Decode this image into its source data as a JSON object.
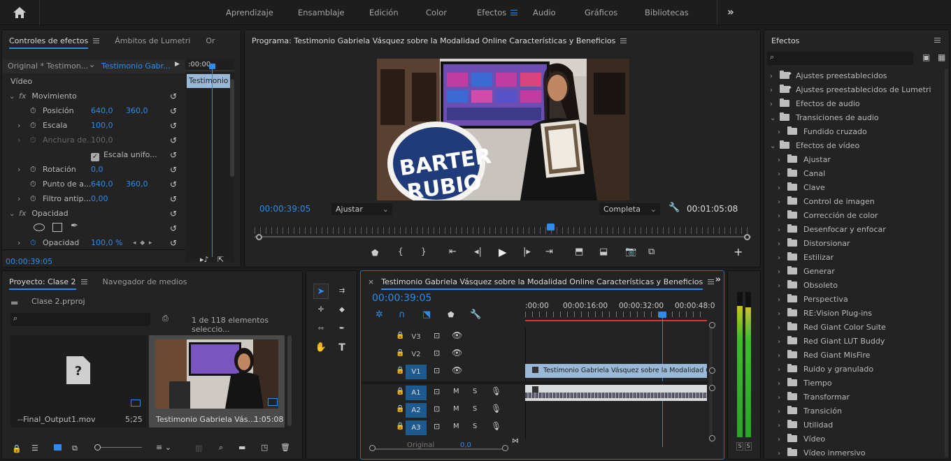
{
  "workspaces": {
    "items": [
      "Aprendizaje",
      "Ensamblaje",
      "Edición",
      "Color",
      "Efectos",
      "Audio",
      "Gráficos",
      "Bibliotecas"
    ],
    "active": "Efectos"
  },
  "effect_controls": {
    "tabs": [
      "Controles de efectos",
      "Ámbitos de Lumetri",
      "Or"
    ],
    "source_master": "Original * Testimon...",
    "source_clip": "Testimonio Gabr...",
    "clip_label": "Testimonio",
    "ruler_time": ":00:00",
    "section": "Vídeo",
    "motion": {
      "label": "Movimiento",
      "position_label": "Posición",
      "position_x": "640,0",
      "position_y": "360,0",
      "scale_label": "Escala",
      "scale": "100,0",
      "width_label": "Anchura de...",
      "width": "100,0",
      "uniform_label": "Escala unifo...",
      "rotation_label": "Rotación",
      "rotation": "0,0",
      "anchor_label": "Punto de a...",
      "anchor_x": "640,0",
      "anchor_y": "360,0",
      "flicker_label": "Filtro antip...",
      "flicker": "0,00"
    },
    "opacity": {
      "label": "Opacidad",
      "value_label": "Opacidad",
      "value": "100,0 %"
    },
    "timecode": "00:00:39:05"
  },
  "program": {
    "title": "Programa: Testimonio Gabriela Vásquez sobre la Modalidad Online Características y Beneficios",
    "timecode": "00:00:39:05",
    "fit": "Ajustar",
    "quality": "Completa",
    "duration": "00:01:05:08",
    "banner_line1": "BARTER",
    "banner_line2": "RUBIO"
  },
  "project": {
    "tabs": [
      "Proyecto: Clase 2",
      "Navegador de medios"
    ],
    "file": "Clase 2.prproj",
    "count": "1 de 118 elementos seleccio...",
    "items": [
      {
        "name": "--Final_Output1.mov",
        "duration": "5;25"
      },
      {
        "name": "Testimonio Gabriela Vás...",
        "duration": "1:05:08"
      }
    ]
  },
  "timeline": {
    "title": "Testimonio Gabriela Vásquez sobre la Modalidad Online Características y Beneficios",
    "timecode": "00:00:39:05",
    "ruler": [
      ":00:00",
      "00:00:16:00",
      "00:00:32:00",
      "00:00:48:0"
    ],
    "tracks": [
      "V3",
      "V2",
      "V1",
      "A1",
      "A2",
      "A3"
    ],
    "clip_name": "Testimonio Gabriela Vásquez sobre la Modalidad Online C",
    "master_label": "Original",
    "master_value": "0,0",
    "mute": "M",
    "solo": "S"
  },
  "effects": {
    "title": "Efectos",
    "items": [
      {
        "label": "Ajustes preestablecidos",
        "level": 0,
        "star": true,
        "open": false
      },
      {
        "label": "Ajustes preestablecidos de Lumetri",
        "level": 0,
        "star": true,
        "open": false
      },
      {
        "label": "Efectos de audio",
        "level": 0,
        "open": false
      },
      {
        "label": "Transiciones de audio",
        "level": 0,
        "open": true
      },
      {
        "label": "Fundido cruzado",
        "level": 1,
        "open": false
      },
      {
        "label": "Efectos de vídeo",
        "level": 0,
        "open": true
      },
      {
        "label": "Ajustar",
        "level": 1
      },
      {
        "label": "Canal",
        "level": 1
      },
      {
        "label": "Clave",
        "level": 1
      },
      {
        "label": "Control de imagen",
        "level": 1
      },
      {
        "label": "Corrección de color",
        "level": 1
      },
      {
        "label": "Desenfocar y enfocar",
        "level": 1
      },
      {
        "label": "Distorsionar",
        "level": 1
      },
      {
        "label": "Estilizar",
        "level": 1
      },
      {
        "label": "Generar",
        "level": 1
      },
      {
        "label": "Obsoleto",
        "level": 1
      },
      {
        "label": "Perspectiva",
        "level": 1
      },
      {
        "label": "RE:Vision Plug-ins",
        "level": 1
      },
      {
        "label": "Red Giant Color Suite",
        "level": 1
      },
      {
        "label": "Red Giant LUT Buddy",
        "level": 1
      },
      {
        "label": "Red Giant MisFire",
        "level": 1
      },
      {
        "label": "Ruido y granulado",
        "level": 1
      },
      {
        "label": "Tiempo",
        "level": 1
      },
      {
        "label": "Transformar",
        "level": 1
      },
      {
        "label": "Transición",
        "level": 1
      },
      {
        "label": "Utilidad",
        "level": 1
      },
      {
        "label": "Vídeo",
        "level": 1
      },
      {
        "label": "Vídeo inmersivo",
        "level": 1
      }
    ]
  },
  "meter": {
    "labels": [
      "S",
      "S"
    ]
  },
  "colors": {
    "accent": "#2d8ceb",
    "clip_video": "#9ab8d8",
    "clip_audio": "#8fb58f",
    "playhead": "#2d8ceb"
  }
}
